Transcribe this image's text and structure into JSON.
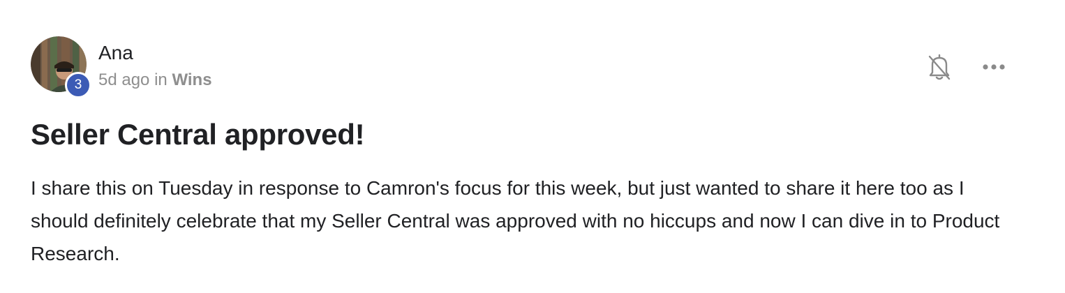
{
  "post": {
    "author": {
      "name": "Ana",
      "level": "3",
      "avatar_icon": "user-avatar-photo"
    },
    "meta": {
      "time_ago": "5d ago",
      "in_word": "in",
      "category": "Wins"
    },
    "actions": {
      "notify_icon": "bell-off-icon",
      "more_icon": "more-horizontal-icon"
    },
    "title": "Seller Central approved!",
    "body": "I share this on Tuesday in response to Camron's focus for this week, but just wanted to share it here too as I should definitely celebrate that my Seller Central was approved with no hiccups and now I can dive in to Product Research."
  },
  "colors": {
    "badge": "#3c5bb5",
    "muted_text": "#8e8e8e",
    "primary_text": "#202124",
    "icon": "#8a8a8a"
  }
}
